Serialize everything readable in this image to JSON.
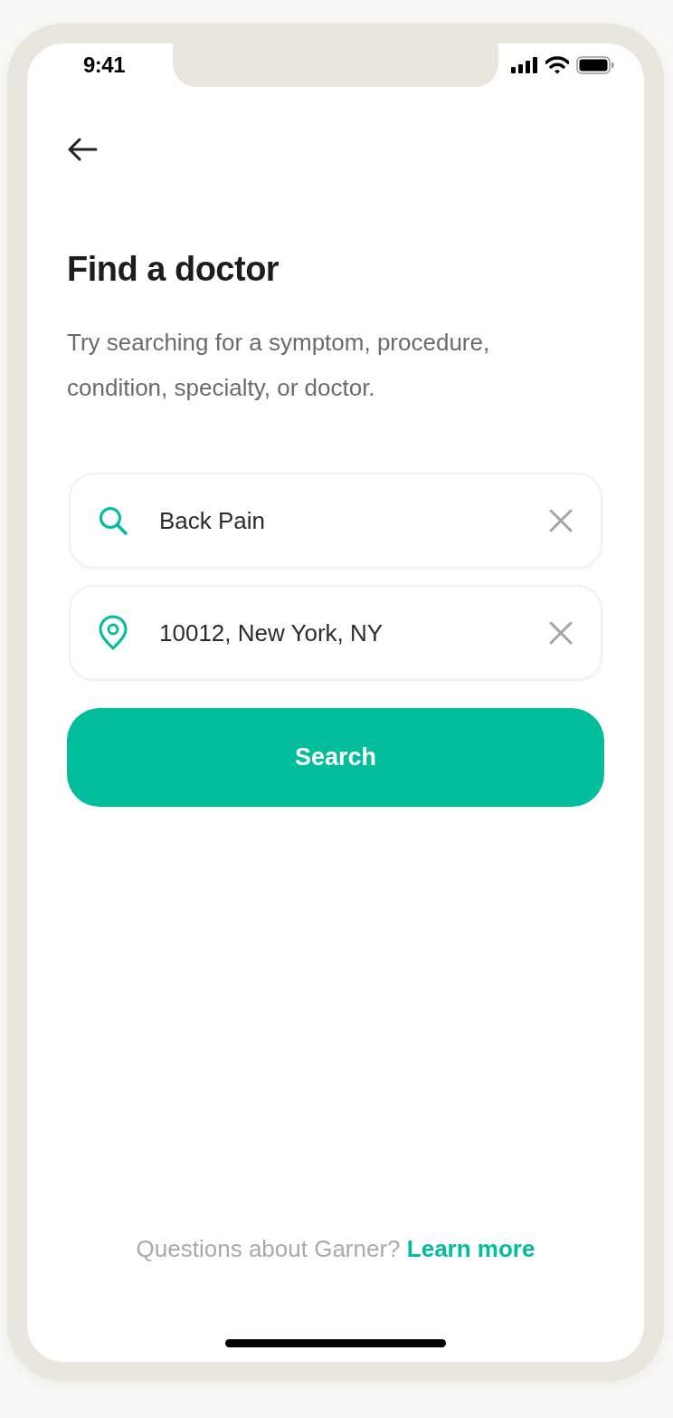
{
  "status_bar": {
    "time": "9:41"
  },
  "title": "Find a doctor",
  "subtitle": "Try searching for a symptom, procedure, condition, specialty, or doctor.",
  "fields": [
    {
      "kind": "search",
      "value": "Back Pain"
    },
    {
      "kind": "location",
      "value": "10012, New York, NY"
    }
  ],
  "search_button": {
    "label": "Search"
  },
  "footer": {
    "text": "Questions about Garner?",
    "link": "Learn more"
  }
}
